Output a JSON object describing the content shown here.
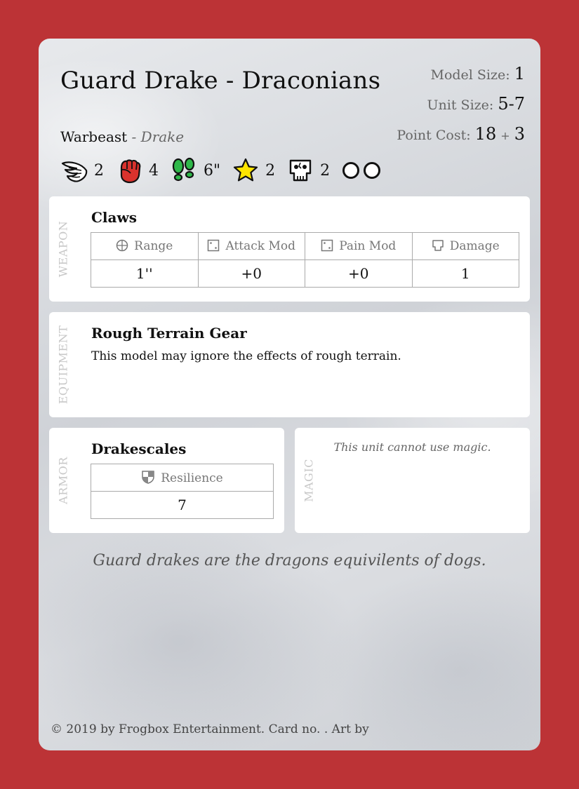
{
  "card": {
    "title": "Guard Drake - Draconians",
    "model_size_label": "Model Size:",
    "model_size": "1",
    "unit_size_label": "Unit Size:",
    "unit_size": "5-7",
    "point_cost_label": "Point Cost:",
    "point_cost": "18",
    "point_cost_plus": "+",
    "point_cost_extra": "3",
    "type": "Warbeast",
    "type_separator": "-",
    "subtype": "Drake"
  },
  "stats": [
    {
      "icon": "wing-icon",
      "value": "2"
    },
    {
      "icon": "fist-icon",
      "value": "4"
    },
    {
      "icon": "footprints-icon",
      "value": "6\""
    },
    {
      "icon": "star-icon",
      "value": "2"
    },
    {
      "icon": "skull-icon",
      "value": "2"
    }
  ],
  "weapon": {
    "label": "WEAPON",
    "name": "Claws",
    "headers": [
      "Range",
      "Attack Mod",
      "Pain Mod",
      "Damage"
    ],
    "values": [
      "1''",
      "+0",
      "+0",
      "1"
    ]
  },
  "equipment": {
    "label": "EQUIPMENT",
    "name": "Rough Terrain Gear",
    "description": "This model may ignore the effects of rough terrain."
  },
  "armor": {
    "label": "ARMOR",
    "name": "Drakescales",
    "header": "Resilience",
    "value": "7"
  },
  "magic": {
    "label": "MAGIC",
    "note": "This unit cannot use magic."
  },
  "flavor": "Guard drakes are the dragons equivilents of dogs.",
  "footer": "© 2019 by Frogbox Entertainment. Card no. . Art by",
  "colors": {
    "border": "#bc3336",
    "fist": "#d9322d",
    "footprints": "#2fb84a",
    "star": "#ffe600"
  }
}
